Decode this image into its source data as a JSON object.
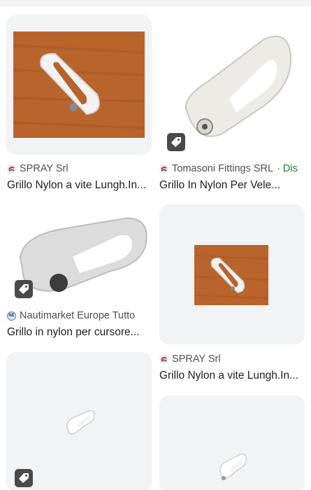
{
  "results": [
    {
      "source": "SPRAY Srl",
      "source_icon": "spray-favicon",
      "title": "Grillo Nylon a vite Lungh.In...",
      "has_tag": false
    },
    {
      "source": "Tomasoni Fittings SRL",
      "source_extra": "· Dis",
      "source_icon": "tomasoni-favicon",
      "title": "Grillo In Nylon Per Vele...",
      "has_tag": true
    },
    {
      "source": "Nautimarket Europe Tutto",
      "source_icon": "nautimarket-favicon",
      "title": "Grillo in nylon per cursore...",
      "has_tag": true
    },
    {
      "source": "SPRAY Srl",
      "source_icon": "spray-favicon",
      "title": "Grillo Nylon a vite Lungh.In...",
      "has_tag": false
    },
    {
      "has_tag": true
    },
    {
      "has_tag": false
    }
  ],
  "nautimarket_icon_text": "NE",
  "colors": {
    "card_bg": "#f1f3f4",
    "wood": "#b8642c",
    "shackle": "#f2f2f0",
    "tag_bg": "#4a4a4a",
    "source_text": "#4d5156",
    "dis_text": "#188038"
  }
}
